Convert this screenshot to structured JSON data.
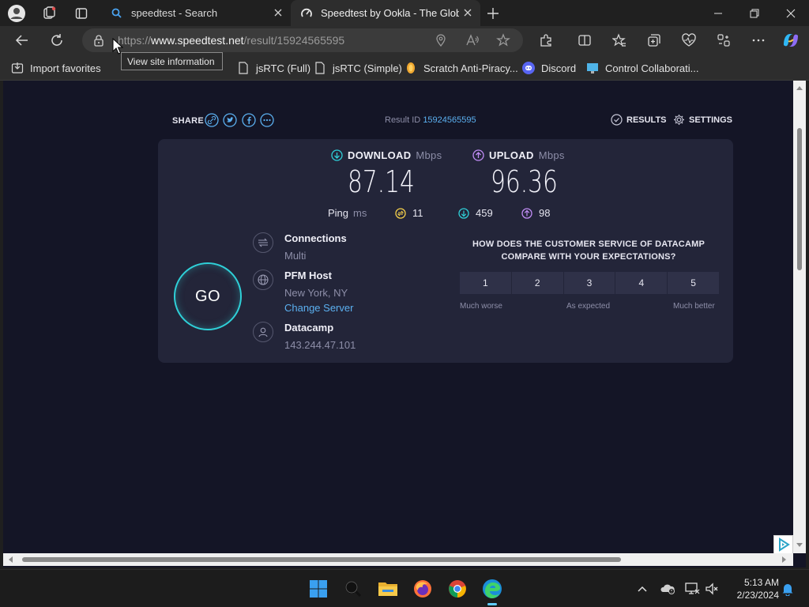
{
  "browser": {
    "tabs": [
      {
        "title": "speedtest - Search",
        "active": false
      },
      {
        "title": "Speedtest by Ookla - The Global",
        "active": true
      }
    ],
    "address": {
      "scheme": "https://",
      "host": "www.speedtest.net",
      "path": "/result/15924565595"
    },
    "tooltip": "View site information",
    "favorites": [
      {
        "label": "Import favorites",
        "icon": "import-icon"
      },
      {
        "label": "jsRTC (Full)",
        "icon": "page-icon"
      },
      {
        "label": "jsRTC (Simple)",
        "icon": "page-icon"
      },
      {
        "label": "Scratch Anti-Piracy...",
        "icon": "scratch-icon"
      },
      {
        "label": "Discord",
        "icon": "discord-icon"
      },
      {
        "label": "Control Collaborati...",
        "icon": "monitor-icon"
      }
    ]
  },
  "speedtest": {
    "share_label": "SHARE",
    "result_label": "Result ID",
    "result_id": "15924565595",
    "nav_results": "RESULTS",
    "nav_settings": "SETTINGS",
    "download": {
      "label": "DOWNLOAD",
      "unit": "Mbps",
      "value": "87.14"
    },
    "upload": {
      "label": "UPLOAD",
      "unit": "Mbps",
      "value": "96.36"
    },
    "ping": {
      "label": "Ping",
      "unit": "ms",
      "idle": "11",
      "down": "459",
      "up": "98"
    },
    "go_label": "GO",
    "connections": {
      "label": "Connections",
      "value": "Multi"
    },
    "host": {
      "label": "PFM Host",
      "location": "New York, NY",
      "change": "Change Server"
    },
    "isp": {
      "label": "Datacamp",
      "ip": "143.244.47.101"
    },
    "survey": {
      "question": "HOW DOES THE CUSTOMER SERVICE OF DATACAMP COMPARE WITH YOUR EXPECTATIONS?",
      "options": [
        "1",
        "2",
        "3",
        "4",
        "5"
      ],
      "low": "Much worse",
      "mid": "As expected",
      "high": "Much better"
    }
  },
  "taskbar": {
    "time": "5:13 AM",
    "date": "2/23/2024"
  },
  "colors": {
    "accent_cyan": "#2fd0d8",
    "upload_purple": "#c08cf5",
    "link_blue": "#5bb0f0",
    "page_bg": "#141526",
    "card_bg": "#232539"
  }
}
